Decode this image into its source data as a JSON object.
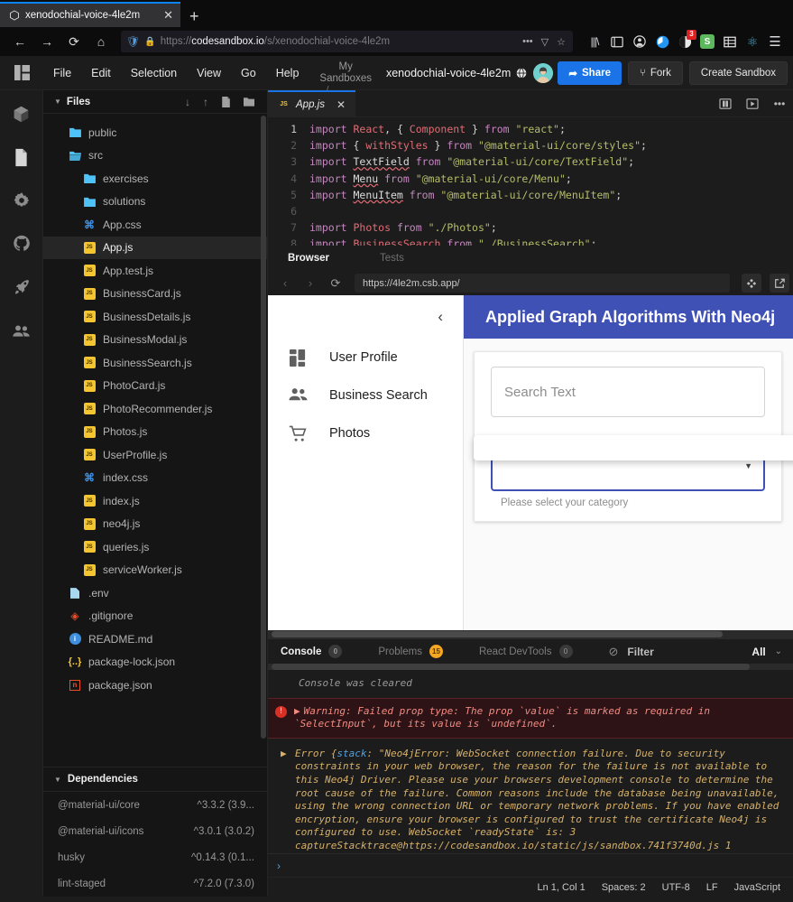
{
  "browser": {
    "tab": {
      "title": "xenodochial-voice-4le2m",
      "favicon_icon": "sandbox-favicon",
      "close_icon": "close-icon"
    },
    "new_tab_label": "+",
    "nav": {
      "back_icon": "back-arrow-icon",
      "forward_icon": "forward-arrow-icon",
      "reload_icon": "reload-icon",
      "home_icon": "home-icon"
    },
    "url": {
      "scheme": "https://",
      "host": "codesandbox.io",
      "path": "/s/xenodochial-voice-4le2m",
      "shield_icon": "shield-icon",
      "lock_icon": "lock-icon",
      "more_icon": "ellipsis-icon",
      "reader_icon": "reader-view-icon",
      "bookmark_icon": "star-icon"
    },
    "extensions": [
      {
        "name": "library-icon",
        "glyph": "|||\\",
        "color": "#d8d8da",
        "badge": ""
      },
      {
        "name": "sidebar-icon",
        "glyph": "▯",
        "color": "#d8d8da",
        "badge": ""
      },
      {
        "name": "account-icon",
        "glyph": "◉",
        "color": "#d8d8da",
        "badge": ""
      },
      {
        "name": "pocket-icon",
        "glyph": "◐",
        "color": "#2196f3",
        "badge": ""
      },
      {
        "name": "darkreader-icon",
        "glyph": "◕",
        "color": "#e8e8e8",
        "badge": "3"
      },
      {
        "name": "screenshot-icon",
        "glyph": "S",
        "color": "#4caf50",
        "badge": ""
      },
      {
        "name": "table-icon",
        "glyph": "▤",
        "color": "#e8e8e8",
        "badge": ""
      },
      {
        "name": "react-devtools-icon",
        "glyph": "⚛",
        "color": "#61dafb",
        "badge": ""
      },
      {
        "name": "menu-icon",
        "glyph": "☰",
        "color": "#d8d8da",
        "badge": ""
      }
    ]
  },
  "csb_header": {
    "logo_icon": "codesandbox-logo-icon",
    "menus": [
      "File",
      "Edit",
      "Selection",
      "View",
      "Go",
      "Help"
    ],
    "my_sandboxes_line1": "My",
    "my_sandboxes_line2": "Sandboxes",
    "breadcrumb_separator": "/",
    "sandbox_title": "xenodochial-voice-4le2m",
    "globe_icon": "globe-icon",
    "avatar_icon": "user-avatar",
    "share_label": "Share",
    "share_icon": "share-arrow-icon",
    "fork_label": "Fork",
    "fork_icon": "fork-icon",
    "create_label": "Create Sandbox",
    "accent_blue": "#1a74e8"
  },
  "activity_bar": [
    {
      "name": "sandbox-explorer",
      "icon": "cube-icon"
    },
    {
      "name": "files",
      "icon": "file-icon"
    },
    {
      "name": "settings",
      "icon": "gear-icon"
    },
    {
      "name": "github",
      "icon": "github-icon"
    },
    {
      "name": "deploy",
      "icon": "rocket-icon"
    },
    {
      "name": "live",
      "icon": "people-icon"
    }
  ],
  "sidebar": {
    "files_title": "Files",
    "collapse_icon": "caret-down-icon",
    "actions": [
      {
        "name": "download-icon",
        "glyph": "↓"
      },
      {
        "name": "upload-icon",
        "glyph": "↑"
      },
      {
        "name": "new-file-icon",
        "glyph": "🗋"
      },
      {
        "name": "new-folder-icon",
        "glyph": "🗀"
      }
    ],
    "files": [
      {
        "label": "public",
        "type": "folder",
        "indent": 1,
        "selected": false
      },
      {
        "label": "src",
        "type": "folder-open",
        "indent": 1,
        "selected": false
      },
      {
        "label": "exercises",
        "type": "folder",
        "indent": 2,
        "selected": false
      },
      {
        "label": "solutions",
        "type": "folder",
        "indent": 2,
        "selected": false
      },
      {
        "label": "App.css",
        "type": "css",
        "indent": 2,
        "selected": false
      },
      {
        "label": "App.js",
        "type": "js",
        "indent": 2,
        "selected": true
      },
      {
        "label": "App.test.js",
        "type": "js",
        "indent": 2,
        "selected": false
      },
      {
        "label": "BusinessCard.js",
        "type": "js",
        "indent": 2,
        "selected": false
      },
      {
        "label": "BusinessDetails.js",
        "type": "js",
        "indent": 2,
        "selected": false
      },
      {
        "label": "BusinessModal.js",
        "type": "js",
        "indent": 2,
        "selected": false
      },
      {
        "label": "BusinessSearch.js",
        "type": "js",
        "indent": 2,
        "selected": false
      },
      {
        "label": "PhotoCard.js",
        "type": "js",
        "indent": 2,
        "selected": false
      },
      {
        "label": "PhotoRecommender.js",
        "type": "js",
        "indent": 2,
        "selected": false
      },
      {
        "label": "Photos.js",
        "type": "js",
        "indent": 2,
        "selected": false
      },
      {
        "label": "UserProfile.js",
        "type": "js",
        "indent": 2,
        "selected": false
      },
      {
        "label": "index.css",
        "type": "css",
        "indent": 2,
        "selected": false
      },
      {
        "label": "index.js",
        "type": "js",
        "indent": 2,
        "selected": false
      },
      {
        "label": "neo4j.js",
        "type": "js",
        "indent": 2,
        "selected": false
      },
      {
        "label": "queries.js",
        "type": "js",
        "indent": 2,
        "selected": false
      },
      {
        "label": "serviceWorker.js",
        "type": "js",
        "indent": 2,
        "selected": false
      },
      {
        "label": ".env",
        "type": "file",
        "indent": 1,
        "selected": false
      },
      {
        "label": ".gitignore",
        "type": "git",
        "indent": 1,
        "selected": false
      },
      {
        "label": "README.md",
        "type": "md",
        "indent": 1,
        "selected": false
      },
      {
        "label": "package-lock.json",
        "type": "json",
        "indent": 1,
        "selected": false
      },
      {
        "label": "package.json",
        "type": "pkg",
        "indent": 1,
        "selected": false
      }
    ],
    "dependencies_title": "Dependencies",
    "dependencies": [
      {
        "name": "@material-ui/core",
        "version": "^3.3.2 (3.9..."
      },
      {
        "name": "@material-ui/icons",
        "version": "^3.0.1 (3.0.2)"
      },
      {
        "name": "husky",
        "version": "^0.14.3 (0.1..."
      },
      {
        "name": "lint-staged",
        "version": "^7.2.0 (7.3.0)"
      }
    ]
  },
  "editor": {
    "tab": {
      "label": "App.js",
      "icon": "js-file-icon",
      "close_icon": "close-icon"
    },
    "actions": [
      {
        "name": "split-pane-icon",
        "glyph": "▥"
      },
      {
        "name": "preview-icon",
        "glyph": "▣"
      },
      {
        "name": "more-options-icon",
        "glyph": "···"
      }
    ],
    "lines": [
      {
        "n": "1",
        "tokens": [
          [
            "k",
            "import "
          ],
          [
            "v",
            "React"
          ],
          [
            "p",
            ", { "
          ],
          [
            "v",
            "Component"
          ],
          [
            "p",
            " } "
          ],
          [
            "k",
            "from "
          ],
          [
            "s",
            "\"react\""
          ],
          [
            "p",
            ";"
          ]
        ]
      },
      {
        "n": "2",
        "tokens": [
          [
            "k",
            "import "
          ],
          [
            "p",
            "{ "
          ],
          [
            "v",
            "withStyles"
          ],
          [
            "p",
            " } "
          ],
          [
            "k",
            "from "
          ],
          [
            "s",
            "\"@material-ui/core/styles\""
          ],
          [
            "p",
            ";"
          ]
        ]
      },
      {
        "n": "3",
        "tokens": [
          [
            "k",
            "import "
          ],
          [
            "u",
            "TextField"
          ],
          [
            "p",
            " "
          ],
          [
            "k",
            "from "
          ],
          [
            "s",
            "\"@material-ui/core/TextField\""
          ],
          [
            "p",
            ";"
          ]
        ]
      },
      {
        "n": "4",
        "tokens": [
          [
            "k",
            "import "
          ],
          [
            "u",
            "Menu"
          ],
          [
            "p",
            " "
          ],
          [
            "k",
            "from "
          ],
          [
            "s",
            "\"@material-ui/core/Menu\""
          ],
          [
            "p",
            ";"
          ]
        ]
      },
      {
        "n": "5",
        "tokens": [
          [
            "k",
            "import "
          ],
          [
            "u",
            "MenuItem"
          ],
          [
            "p",
            " "
          ],
          [
            "k",
            "from "
          ],
          [
            "s",
            "\"@material-ui/core/MenuItem\""
          ],
          [
            "p",
            ";"
          ]
        ]
      },
      {
        "n": "6",
        "tokens": []
      },
      {
        "n": "7",
        "tokens": [
          [
            "k",
            "import "
          ],
          [
            "v",
            "Photos"
          ],
          [
            "p",
            " "
          ],
          [
            "k",
            "from "
          ],
          [
            "s",
            "\"./Photos\""
          ],
          [
            "p",
            ";"
          ]
        ]
      },
      {
        "n": "8",
        "tokens": [
          [
            "k",
            "import "
          ],
          [
            "v",
            "BusinessSearch"
          ],
          [
            "p",
            " "
          ],
          [
            "k",
            "from "
          ],
          [
            "s",
            "\"./BusinessSearch\""
          ],
          [
            "p",
            ";"
          ]
        ]
      }
    ]
  },
  "preview": {
    "tabs": [
      {
        "label": "Browser",
        "active": true
      },
      {
        "label": "Tests",
        "active": false
      }
    ],
    "nav": {
      "back_icon": "back-arrow-icon",
      "forward_icon": "forward-arrow-icon",
      "reload_icon": "reload-icon"
    },
    "url": "https://4le2m.csb.app/",
    "actions": [
      {
        "name": "responsive-mode-icon",
        "glyph": "✦"
      },
      {
        "name": "open-external-icon",
        "glyph": "⇱"
      }
    ],
    "app": {
      "appbar_title": "Applied Graph Algorithms With Neo4j",
      "appbar_color": "#3f51b5",
      "drawer_collapse_icon": "chevron-left-icon",
      "drawer_items": [
        {
          "label": "User Profile",
          "icon": "dashboard-icon"
        },
        {
          "label": "Business Search",
          "icon": "people-icon"
        },
        {
          "label": "Photos",
          "icon": "shopping-cart-icon"
        }
      ],
      "search_placeholder": "Search Text",
      "select_value": "",
      "select_helper": "Please select your category",
      "select_arrow_icon": "dropdown-arrow-icon",
      "focus_color": "#3f51b5"
    }
  },
  "console": {
    "tabs": [
      {
        "label": "Console",
        "badge": "0",
        "active": true,
        "warn": false
      },
      {
        "label": "Problems",
        "badge": "15",
        "active": false,
        "warn": true
      },
      {
        "label": "React DevTools",
        "badge": "0",
        "active": false,
        "warn": false
      }
    ],
    "clear_icon": "clear-console-icon",
    "filter_placeholder": "Filter",
    "level_label": "All",
    "chevron_icon": "chevron-down-icon",
    "cleared_message": "Console was cleared",
    "warning": {
      "icon": "error-icon",
      "expand_icon": "▶",
      "text": "Warning: Failed prop type: The prop `value` is marked as required in `SelectInput`, but its value is `undefined`."
    },
    "error": {
      "expand_icon": "▶",
      "prefix": "Error {",
      "stack_key": "stack",
      "text": ": \"Neo4jError: WebSocket connection failure. Due to security constraints in your web browser, the reason for the failure is not available to this Neo4j Driver. Please use your browsers development console to determine the root cause of the failure. Common reasons include the database being unavailable, using the wrong connection URL or temporary network problems. If you have enabled encryption, ensure your browser is configured to trust the certificate Neo4j is configured to use. WebSocket `readyState` is: 3",
      "stacktrace": "captureStacktrace@https://codesandbox.io/static/js/sandbox.741f3740d.js 1"
    },
    "prompt_icon": "›"
  },
  "statusbar": {
    "position": "Ln 1, Col 1",
    "spaces": "Spaces: 2",
    "encoding": "UTF-8",
    "eol": "LF",
    "language": "JavaScript"
  }
}
